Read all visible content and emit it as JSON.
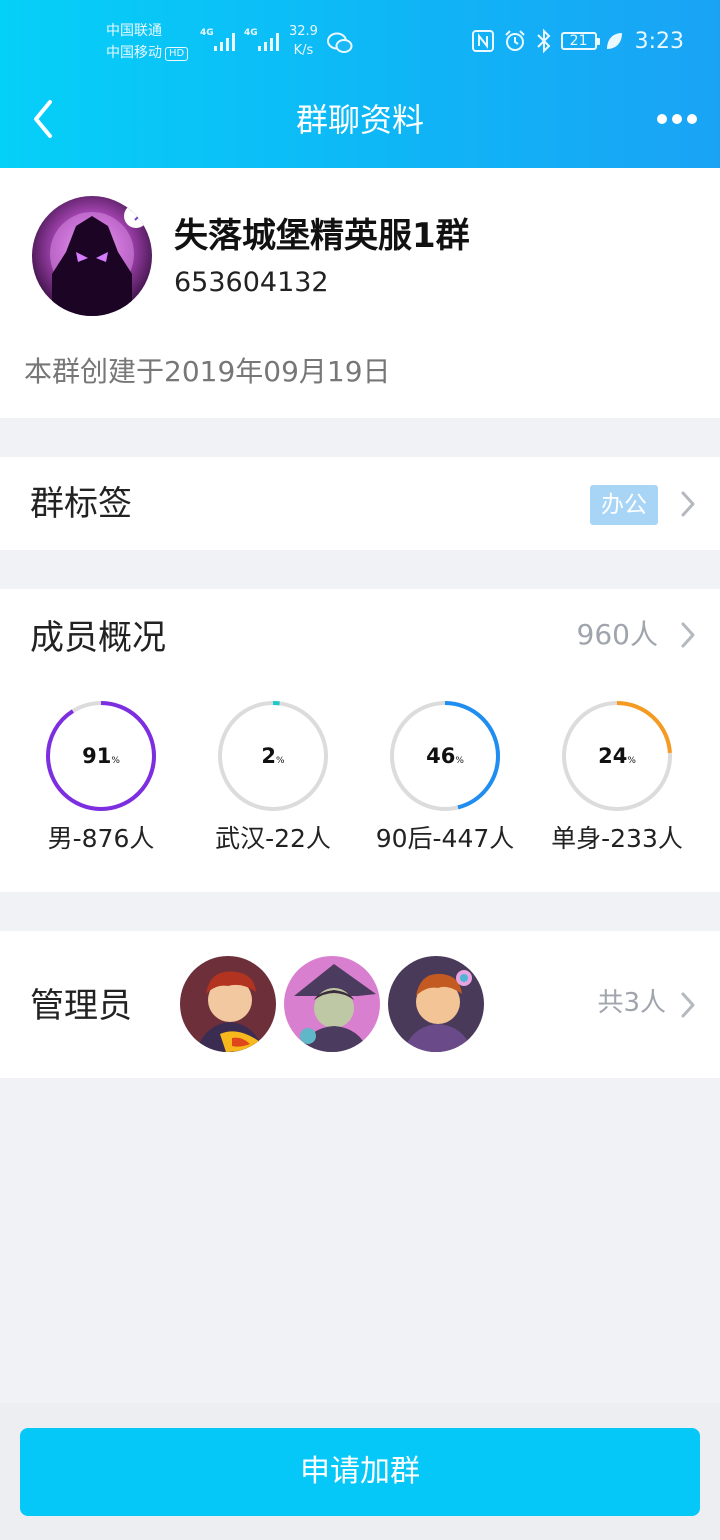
{
  "status_bar": {
    "carrier_1": "中国联通",
    "carrier_2": "中国移动",
    "hd": "HD",
    "net_1": "4G",
    "net_2": "4G",
    "speed_value": "32.9",
    "speed_unit": "K/s",
    "battery": "21",
    "time": "3:23"
  },
  "nav": {
    "title": "群聊资料"
  },
  "profile": {
    "name": "失落城堡精英服1群",
    "id": "653604132",
    "created": "本群创建于2019年09月19日"
  },
  "tags": {
    "label": "群标签",
    "tag": "办公"
  },
  "members": {
    "label": "成员概况",
    "count": "960人",
    "stats": [
      {
        "value": "91",
        "percent": 91,
        "unit": "%",
        "label": "男-876人",
        "color": "#7d2ee0"
      },
      {
        "value": "2",
        "percent": 2,
        "unit": "%",
        "label": "武汉-22人",
        "color": "#1fc9c9"
      },
      {
        "value": "46",
        "percent": 46,
        "unit": "%",
        "label": "90后-447人",
        "color": "#1f8ef0"
      },
      {
        "value": "24",
        "percent": 24,
        "unit": "%",
        "label": "单身-233人",
        "color": "#f59b22"
      }
    ]
  },
  "admins": {
    "label": "管理员",
    "count": "共3人"
  },
  "actions": {
    "join": "申请加群"
  }
}
